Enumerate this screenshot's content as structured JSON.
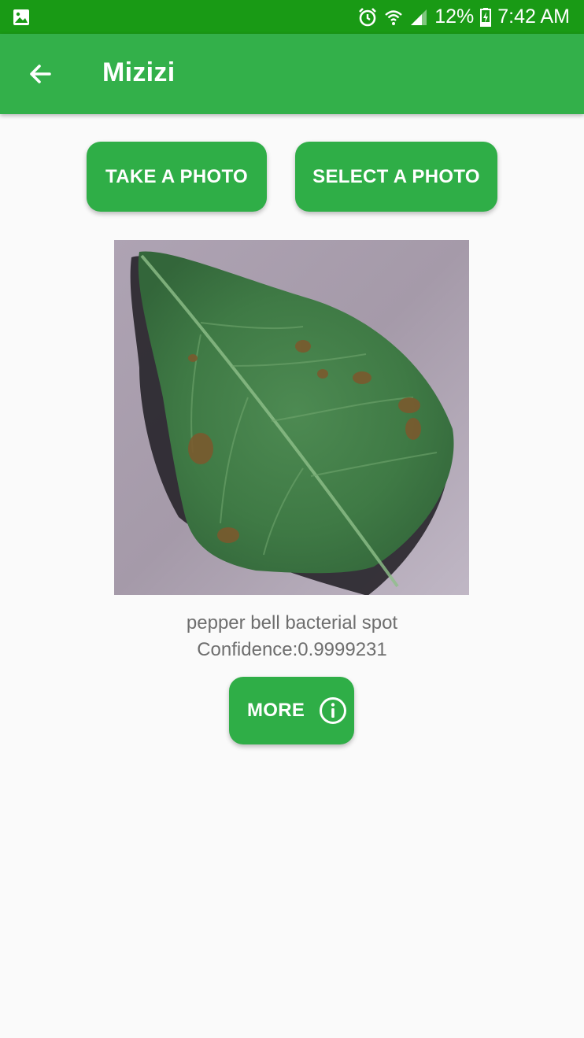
{
  "status_bar": {
    "battery": "12%",
    "time": "7:42 AM",
    "icons": [
      "image-notification-icon",
      "alarm-icon",
      "wifi-icon",
      "signal-icon",
      "battery-charging-icon"
    ]
  },
  "app_bar": {
    "title": "Mizizi",
    "back_icon": "arrow-left-icon"
  },
  "actions": {
    "take_photo": "TAKE A PHOTO",
    "select_photo": "SELECT A PHOTO"
  },
  "result": {
    "image_subject": "pepper leaf photo",
    "label": "pepper bell bacterial spot",
    "confidence": "Confidence:0.9999231"
  },
  "more_button": {
    "label": "MORE",
    "icon": "info-icon"
  },
  "colors": {
    "status_bar": "#199a15",
    "primary": "#33b04a",
    "button": "#2fae47",
    "text_secondary": "#6e6e6e"
  }
}
